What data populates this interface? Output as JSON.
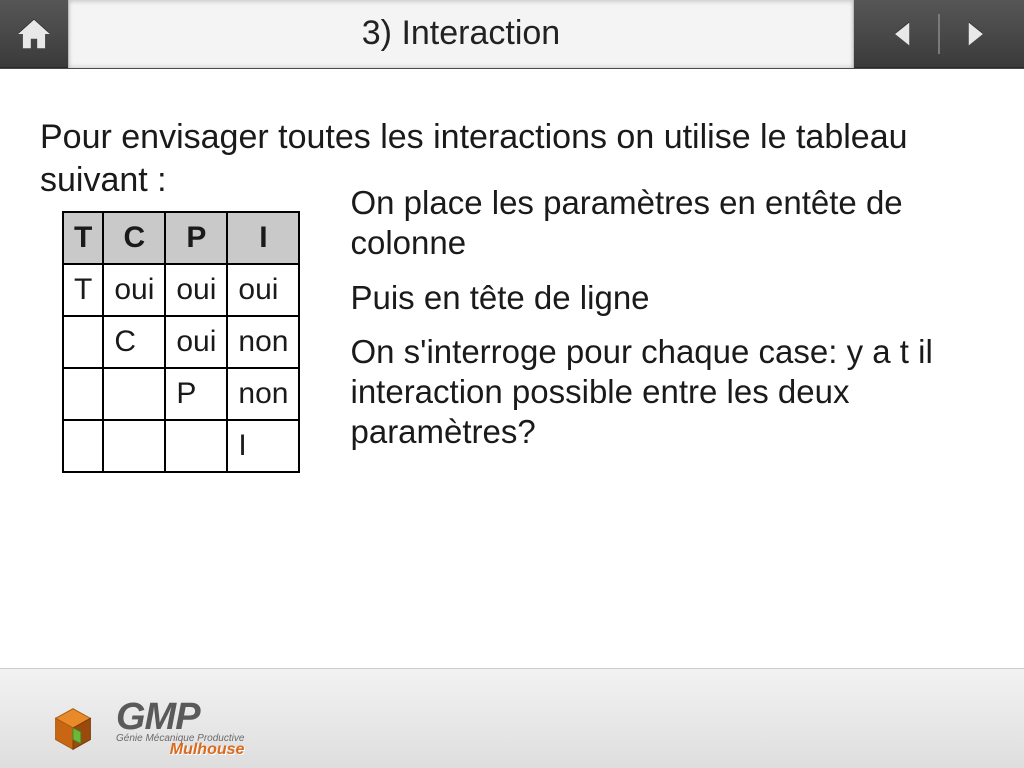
{
  "header": {
    "title": "3) Interaction"
  },
  "content": {
    "intro": "Pour envisager toutes les interactions on utilise le tableau suivant :",
    "table": {
      "headers": [
        "T",
        "C",
        "P",
        "I"
      ],
      "rows": [
        {
          "label": "T",
          "cells": [
            "oui",
            "oui",
            "oui"
          ]
        },
        {
          "label": "",
          "cells": [
            "C",
            "oui",
            "non"
          ]
        },
        {
          "label": "",
          "cells": [
            "",
            "P",
            "non"
          ]
        },
        {
          "label": "",
          "cells": [
            "",
            "",
            "I"
          ]
        }
      ]
    },
    "explain": {
      "p1": "On place les paramètres en entête de colonne",
      "p2": "Puis en tête de ligne",
      "p3": "On s'interroge pour chaque case: y a t il interaction possible entre les deux paramètres?"
    }
  },
  "logo": {
    "name": "GMP",
    "subtitle": "Génie Mécanique Productive",
    "city": "Mulhouse"
  }
}
